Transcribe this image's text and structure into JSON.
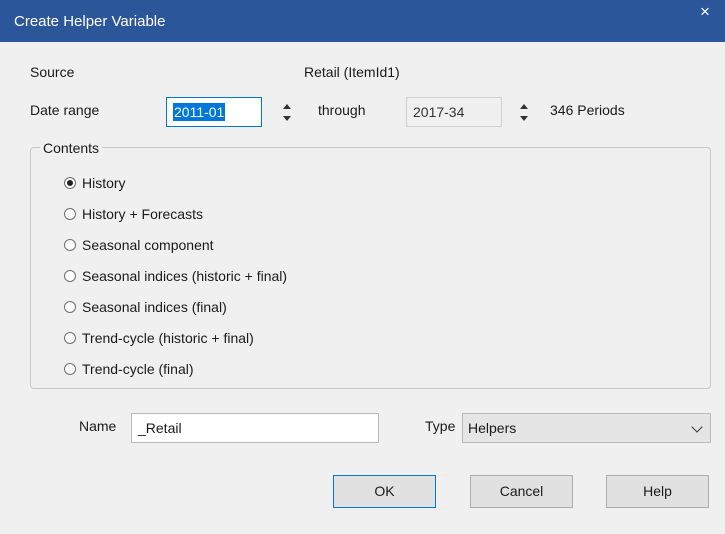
{
  "window": {
    "title": "Create Helper Variable",
    "close_label": "×"
  },
  "source": {
    "label": "Source",
    "value": "Retail (ItemId1)"
  },
  "date_range": {
    "label": "Date range",
    "start_value": "2011-01",
    "through_label": "through",
    "end_value": "2017-34",
    "periods_text": "346 Periods"
  },
  "contents": {
    "title": "Contents",
    "selected_index": 0,
    "options": [
      "History",
      "History + Forecasts",
      "Seasonal component",
      "Seasonal indices (historic + final)",
      "Seasonal indices (final)",
      "Trend-cycle (historic + final)",
      "Trend-cycle (final)"
    ]
  },
  "name": {
    "label": "Name",
    "value": "_Retail"
  },
  "type": {
    "label": "Type",
    "selected": "Helpers"
  },
  "buttons": {
    "ok": "OK",
    "cancel": "Cancel",
    "help": "Help"
  },
  "colors": {
    "titlebar": "#2b579a",
    "focus": "#0078d7",
    "background": "#f0f0f0"
  }
}
